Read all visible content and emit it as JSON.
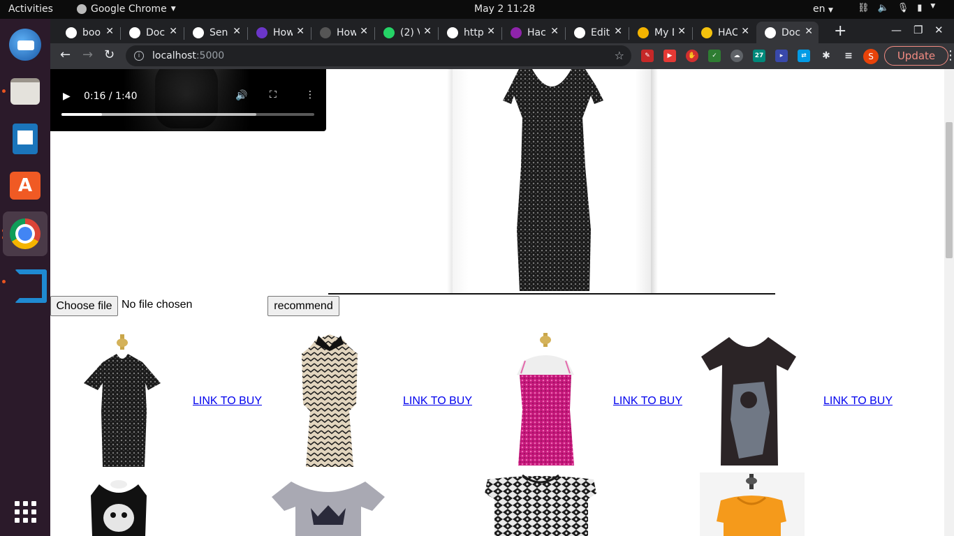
{
  "topbar": {
    "activities": "Activities",
    "app_name": "Google Chrome",
    "clock": "May 2  11:28",
    "lang": "en"
  },
  "browser": {
    "tabs": [
      {
        "title": "boo",
        "icon": "google-icon",
        "color": "#ffffff"
      },
      {
        "title": "Doc",
        "icon": "globe-icon",
        "color": "#ffffff"
      },
      {
        "title": "Sen",
        "icon": "medium-icon",
        "color": "#ffffff"
      },
      {
        "title": "How",
        "icon": "py-icon",
        "color": "#6b36c9"
      },
      {
        "title": "How",
        "icon": "howto-icon",
        "color": "#555555"
      },
      {
        "title": "(2) V",
        "icon": "whatsapp-icon",
        "color": "#25d366"
      },
      {
        "title": "http",
        "icon": "globe-icon",
        "color": "#ffffff"
      },
      {
        "title": "Hac",
        "icon": "list-icon",
        "color": "#8e24aa"
      },
      {
        "title": "Edit",
        "icon": "github-icon",
        "color": "#ffffff"
      },
      {
        "title": "My D",
        "icon": "drive-icon",
        "color": "#f4b400"
      },
      {
        "title": "HAC",
        "icon": "slides-icon",
        "color": "#f4c20d"
      },
      {
        "title": "Doc",
        "icon": "globe-icon",
        "color": "#ffffff",
        "active": true
      }
    ],
    "url_host": "localhost",
    "url_port": ":5000",
    "update_label": "Update",
    "profile_initial": "S"
  },
  "video": {
    "time_display": "0:16 / 1:40",
    "played_fraction": 0.16,
    "buffered_fraction": 0.77
  },
  "form": {
    "choose_file_label": "Choose file",
    "file_status": "No file chosen",
    "recommend_label": "recommend"
  },
  "products": [
    {
      "link_text": "LINK TO BUY",
      "desc": "black sequin dress",
      "color": "#1c1c1c"
    },
    {
      "link_text": "LINK TO BUY",
      "desc": "chevron dress",
      "color": "#cdbfa8"
    },
    {
      "link_text": "LINK TO BUY",
      "desc": "pink sequin dress",
      "color": "#d61c82"
    },
    {
      "link_text": "LINK TO BUY",
      "desc": "graphic tee",
      "color": "#2b2426"
    }
  ],
  "products_row2": [
    {
      "desc": "graphic tank",
      "color": "#111111"
    },
    {
      "desc": "crown tee",
      "color": "#a9a9b3"
    },
    {
      "desc": "patterned top",
      "color": "#444444"
    },
    {
      "desc": "orange top",
      "color": "#f59a1b"
    }
  ]
}
